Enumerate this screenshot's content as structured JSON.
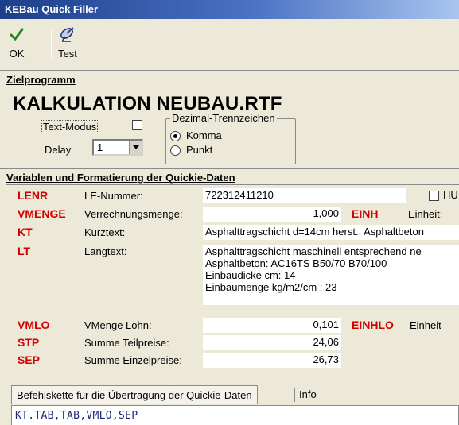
{
  "window": {
    "title": "KEBau Quick Filler"
  },
  "toolbar": {
    "ok_label": "OK",
    "test_label": "Test"
  },
  "target": {
    "section_title": "Zielprogramm",
    "program_name": "KALKULATION NEUBAU.RTF",
    "text_mode_label": "Text-Modus",
    "delay_label": "Delay",
    "delay_value": "1",
    "decimal_group_title": "Dezimal-Trennzeichen",
    "decimal_options": [
      {
        "label": "Komma",
        "selected": true
      },
      {
        "label": "Punkt",
        "selected": false
      }
    ]
  },
  "variables": {
    "section_title": "Variablen und  Formatierung der Quickie-Daten",
    "rows": [
      {
        "code": "LENR",
        "label": "LE-Nummer:",
        "value": "722312411210"
      },
      {
        "code": "VMENGE",
        "label": "Verrechnungsmenge:",
        "value": "1,000",
        "extra_code": "EINH",
        "extra_label": "Einheit:"
      },
      {
        "code": "KT",
        "label": "Kurztext:",
        "value": "Asphalttragschicht d=14cm herst., Asphaltbeton"
      },
      {
        "code": "LT",
        "label": "Langtext:",
        "lines": [
          "Asphalttragschicht maschinell entsprechend ne",
          "Asphaltbeton: AC16TS B50/70 B70/100",
          "Einbaudicke cm: 14",
          "Einbaumenge kg/m2/cm : 23"
        ]
      },
      {
        "code": "VMLO",
        "label": "VMenge Lohn:",
        "value": "0,101",
        "extra_code": "EINHLO",
        "extra_label": "Einheit"
      },
      {
        "code": "STP",
        "label": "Summe Teilpreise:",
        "value": "24,06"
      },
      {
        "code": "SEP",
        "label": "Summe Einzelpreise:",
        "value": "26,73"
      }
    ],
    "hu_label": "HU"
  },
  "tabs": [
    {
      "label": "Befehlskette für die Übertragung der Quickie-Daten",
      "active": true
    },
    {
      "label": "Info",
      "active": false
    }
  ],
  "command_chain": "KT.TAB,TAB,VMLO,SEP",
  "colors": {
    "code_red": "#d40000",
    "title_blue": "#1d3e8a",
    "command_blue": "#1a2a78"
  },
  "icons": {
    "ok": "checkmark-icon",
    "test": "satellite-dish-icon"
  }
}
